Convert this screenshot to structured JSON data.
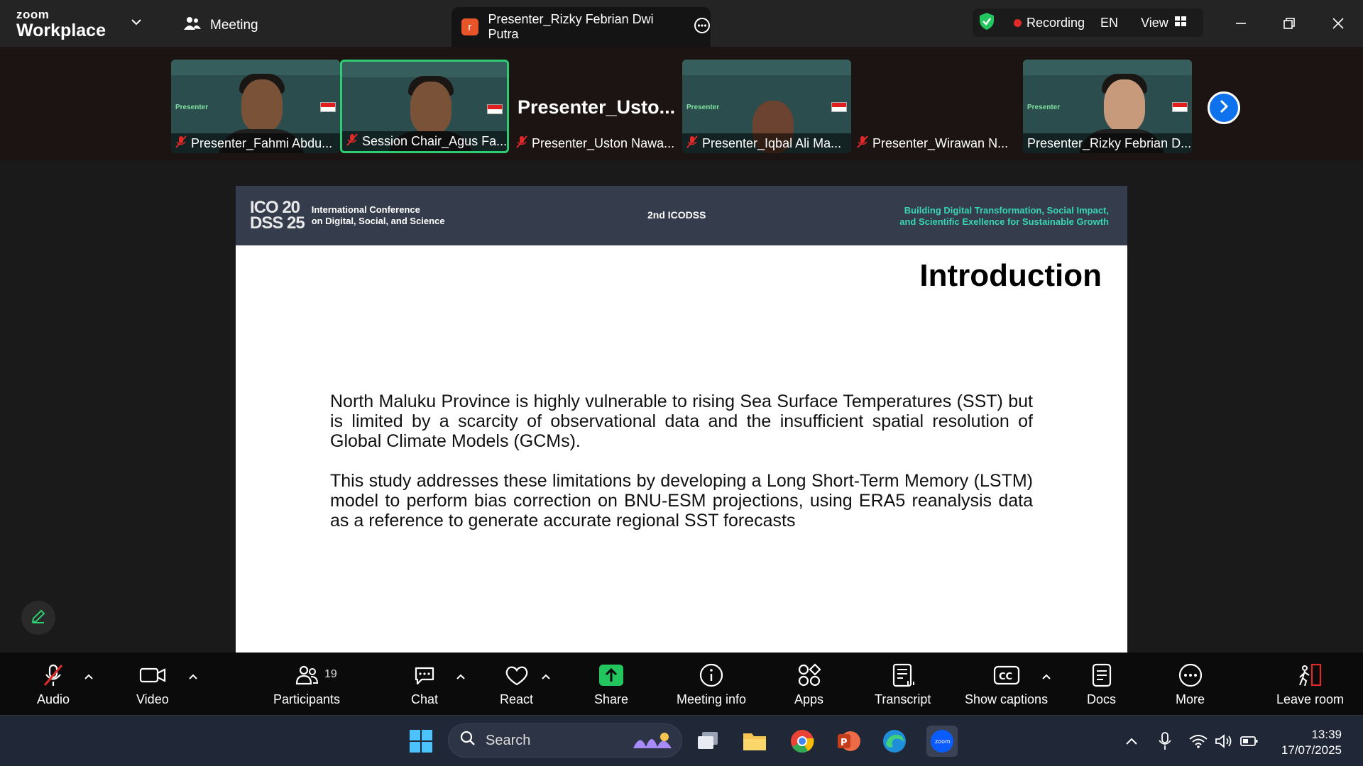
{
  "app": {
    "brand_top": "zoom",
    "brand_bottom": "Workplace",
    "meeting_label": "Meeting",
    "active_tab": {
      "badge": "r",
      "title": "Presenter_Rizky Febrian Dwi Putra"
    },
    "status": {
      "recording": "Recording",
      "language": "EN",
      "view": "View"
    }
  },
  "gallery": {
    "tiles": [
      {
        "name": "Presenter_Fahmi Abdu...",
        "tag": "Presenter",
        "muted": true
      },
      {
        "name": "Session Chair_Agus Fa...",
        "tag": "",
        "muted": true,
        "active": true
      },
      {
        "name": "Presenter_Uston Nawa...",
        "big_label": "Presenter_Usto...",
        "muted": true
      },
      {
        "name": "Presenter_Iqbal Ali Ma...",
        "tag": "Presenter",
        "muted": true
      },
      {
        "name": "Presenter_Wirawan N...",
        "muted": true
      },
      {
        "name": "Presenter_Rizky Febrian D...",
        "tag": "Presenter",
        "muted": true
      }
    ]
  },
  "slide": {
    "logo_mark_top": "ICO 20",
    "logo_mark_bottom": "DSS 25",
    "conference_line1": "International Conference",
    "conference_line2": "on Digital, Social, and Science",
    "edition": "2nd ICODSS",
    "tagline_line1": "Building Digital Transformation, Social Impact,",
    "tagline_line2": "and Scientific Exellence for Sustainable Growth",
    "title": "Introduction",
    "paragraph1": "North Maluku Province is highly vulnerable to rising Sea Surface Temperatures (SST) but is limited by a scarcity of observational data and the insufficient spatial resolution of Global Climate Models (GCMs).",
    "paragraph2": "This study addresses these limitations by developing a Long Short-Term Memory (LSTM) model to perform bias correction on BNU-ESM projections, using ERA5 reanalysis data as a reference to generate accurate regional SST forecasts"
  },
  "toolbar": {
    "audio": "Audio",
    "video": "Video",
    "participants": "Participants",
    "participants_count": "19",
    "chat": "Chat",
    "react": "React",
    "share": "Share",
    "meeting_info": "Meeting info",
    "apps": "Apps",
    "transcript": "Transcript",
    "show_captions": "Show captions",
    "docs": "Docs",
    "more": "More",
    "leave": "Leave room"
  },
  "taskbar": {
    "search_placeholder": "Search",
    "time": "13:39",
    "date": "17/07/2025"
  },
  "colors": {
    "accent_green": "#2ecc71",
    "zoom_blue": "#0e72ed",
    "record_red": "#e02a2a",
    "tagline_teal": "#38d6b4"
  }
}
